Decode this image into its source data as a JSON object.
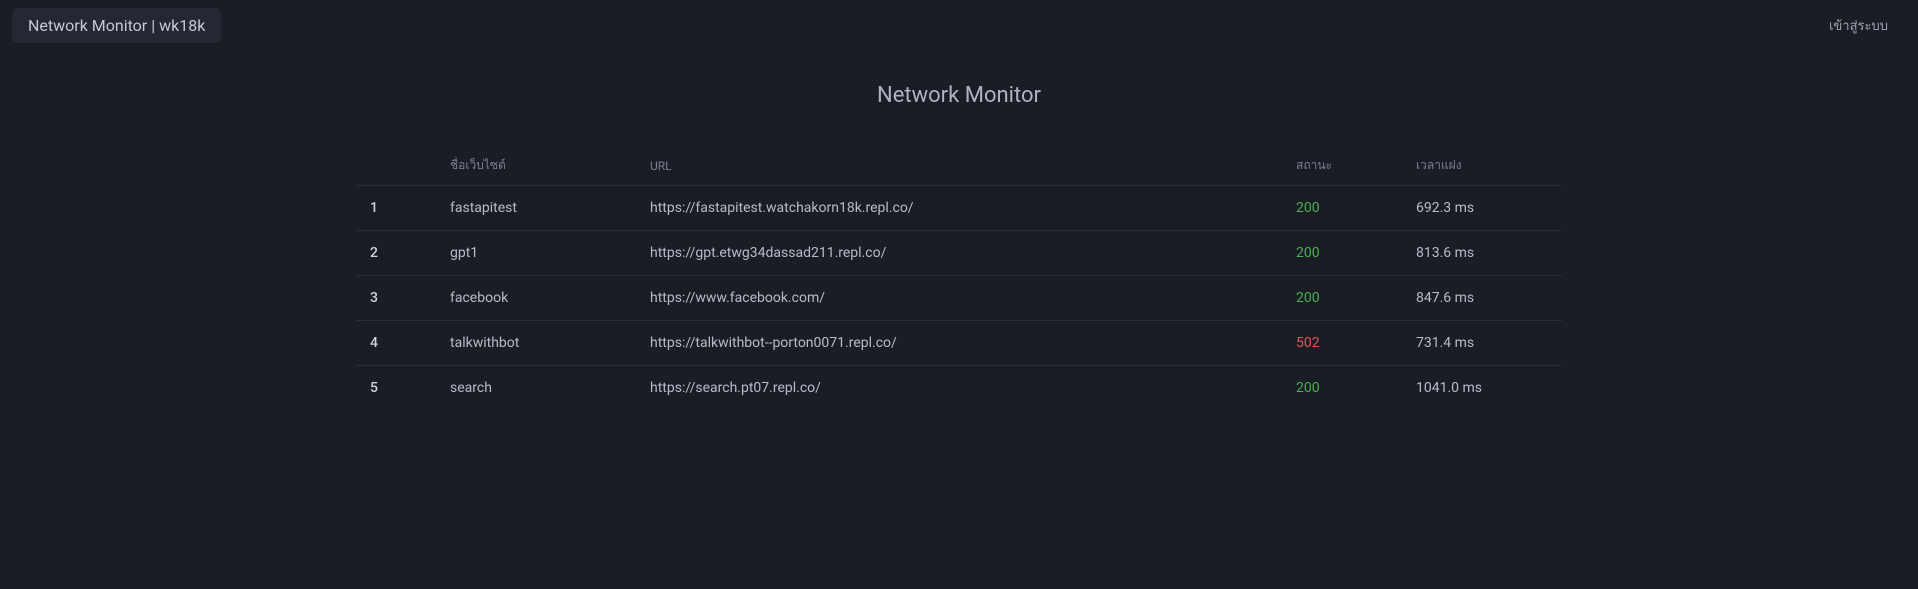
{
  "header": {
    "brand": "Network Monitor | wk18k",
    "login": "เข้าสู่ระบบ"
  },
  "page": {
    "title": "Network Monitor"
  },
  "table": {
    "headers": {
      "index": "",
      "name": "ชื่อเว็บไซต์",
      "url": "URL",
      "status": "สถานะ",
      "latency": "เวลาแฝง"
    },
    "rows": [
      {
        "index": "1",
        "name": "fastapitest",
        "url": "https://fastapitest.watchakorn18k.repl.co/",
        "status": "200",
        "status_ok": true,
        "latency": "692.3 ms"
      },
      {
        "index": "2",
        "name": "gpt1",
        "url": "https://gpt.etwg34dassad211.repl.co/",
        "status": "200",
        "status_ok": true,
        "latency": "813.6 ms"
      },
      {
        "index": "3",
        "name": "facebook",
        "url": "https://www.facebook.com/",
        "status": "200",
        "status_ok": true,
        "latency": "847.6 ms"
      },
      {
        "index": "4",
        "name": "talkwithbot",
        "url": "https://talkwithbot--porton0071.repl.co/",
        "status": "502",
        "status_ok": false,
        "latency": "731.4 ms"
      },
      {
        "index": "5",
        "name": "search",
        "url": "https://search.pt07.repl.co/",
        "status": "200",
        "status_ok": true,
        "latency": "1041.0 ms"
      }
    ]
  }
}
